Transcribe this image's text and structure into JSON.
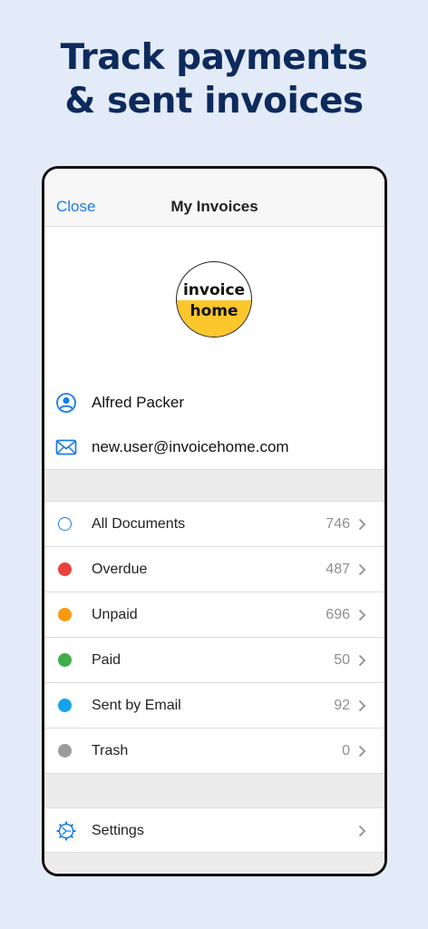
{
  "headline": {
    "line1": "Track payments",
    "line2": "& sent invoices"
  },
  "nav": {
    "close_label": "Close",
    "title": "My Invoices"
  },
  "logo": {
    "line1": "invoice",
    "line2": "home"
  },
  "profile": {
    "name": "Alfred Packer",
    "email": "new.user@invoicehome.com"
  },
  "documents": [
    {
      "label": "All Documents",
      "count": "746",
      "color": "#1a7ce8",
      "hollow": true,
      "icon": "circle-outline-icon"
    },
    {
      "label": "Overdue",
      "count": "487",
      "color": "#e8423a",
      "hollow": false,
      "icon": "red-dot-icon"
    },
    {
      "label": "Unpaid",
      "count": "696",
      "color": "#f79a10",
      "hollow": false,
      "icon": "orange-dot-icon"
    },
    {
      "label": "Paid",
      "count": "50",
      "color": "#3fae4a",
      "hollow": false,
      "icon": "green-dot-icon"
    },
    {
      "label": "Sent by Email",
      "count": "92",
      "color": "#14a3ec",
      "hollow": false,
      "icon": "blue-dot-icon"
    },
    {
      "label": "Trash",
      "count": "0",
      "color": "#9b9b9b",
      "hollow": false,
      "icon": "gray-dot-icon"
    }
  ],
  "settings": {
    "label": "Settings"
  },
  "colors": {
    "accent": "#1a7ce8",
    "headline": "#0d2a5c",
    "background": "#e3ebf8",
    "brand_yellow": "#fcc62d"
  }
}
